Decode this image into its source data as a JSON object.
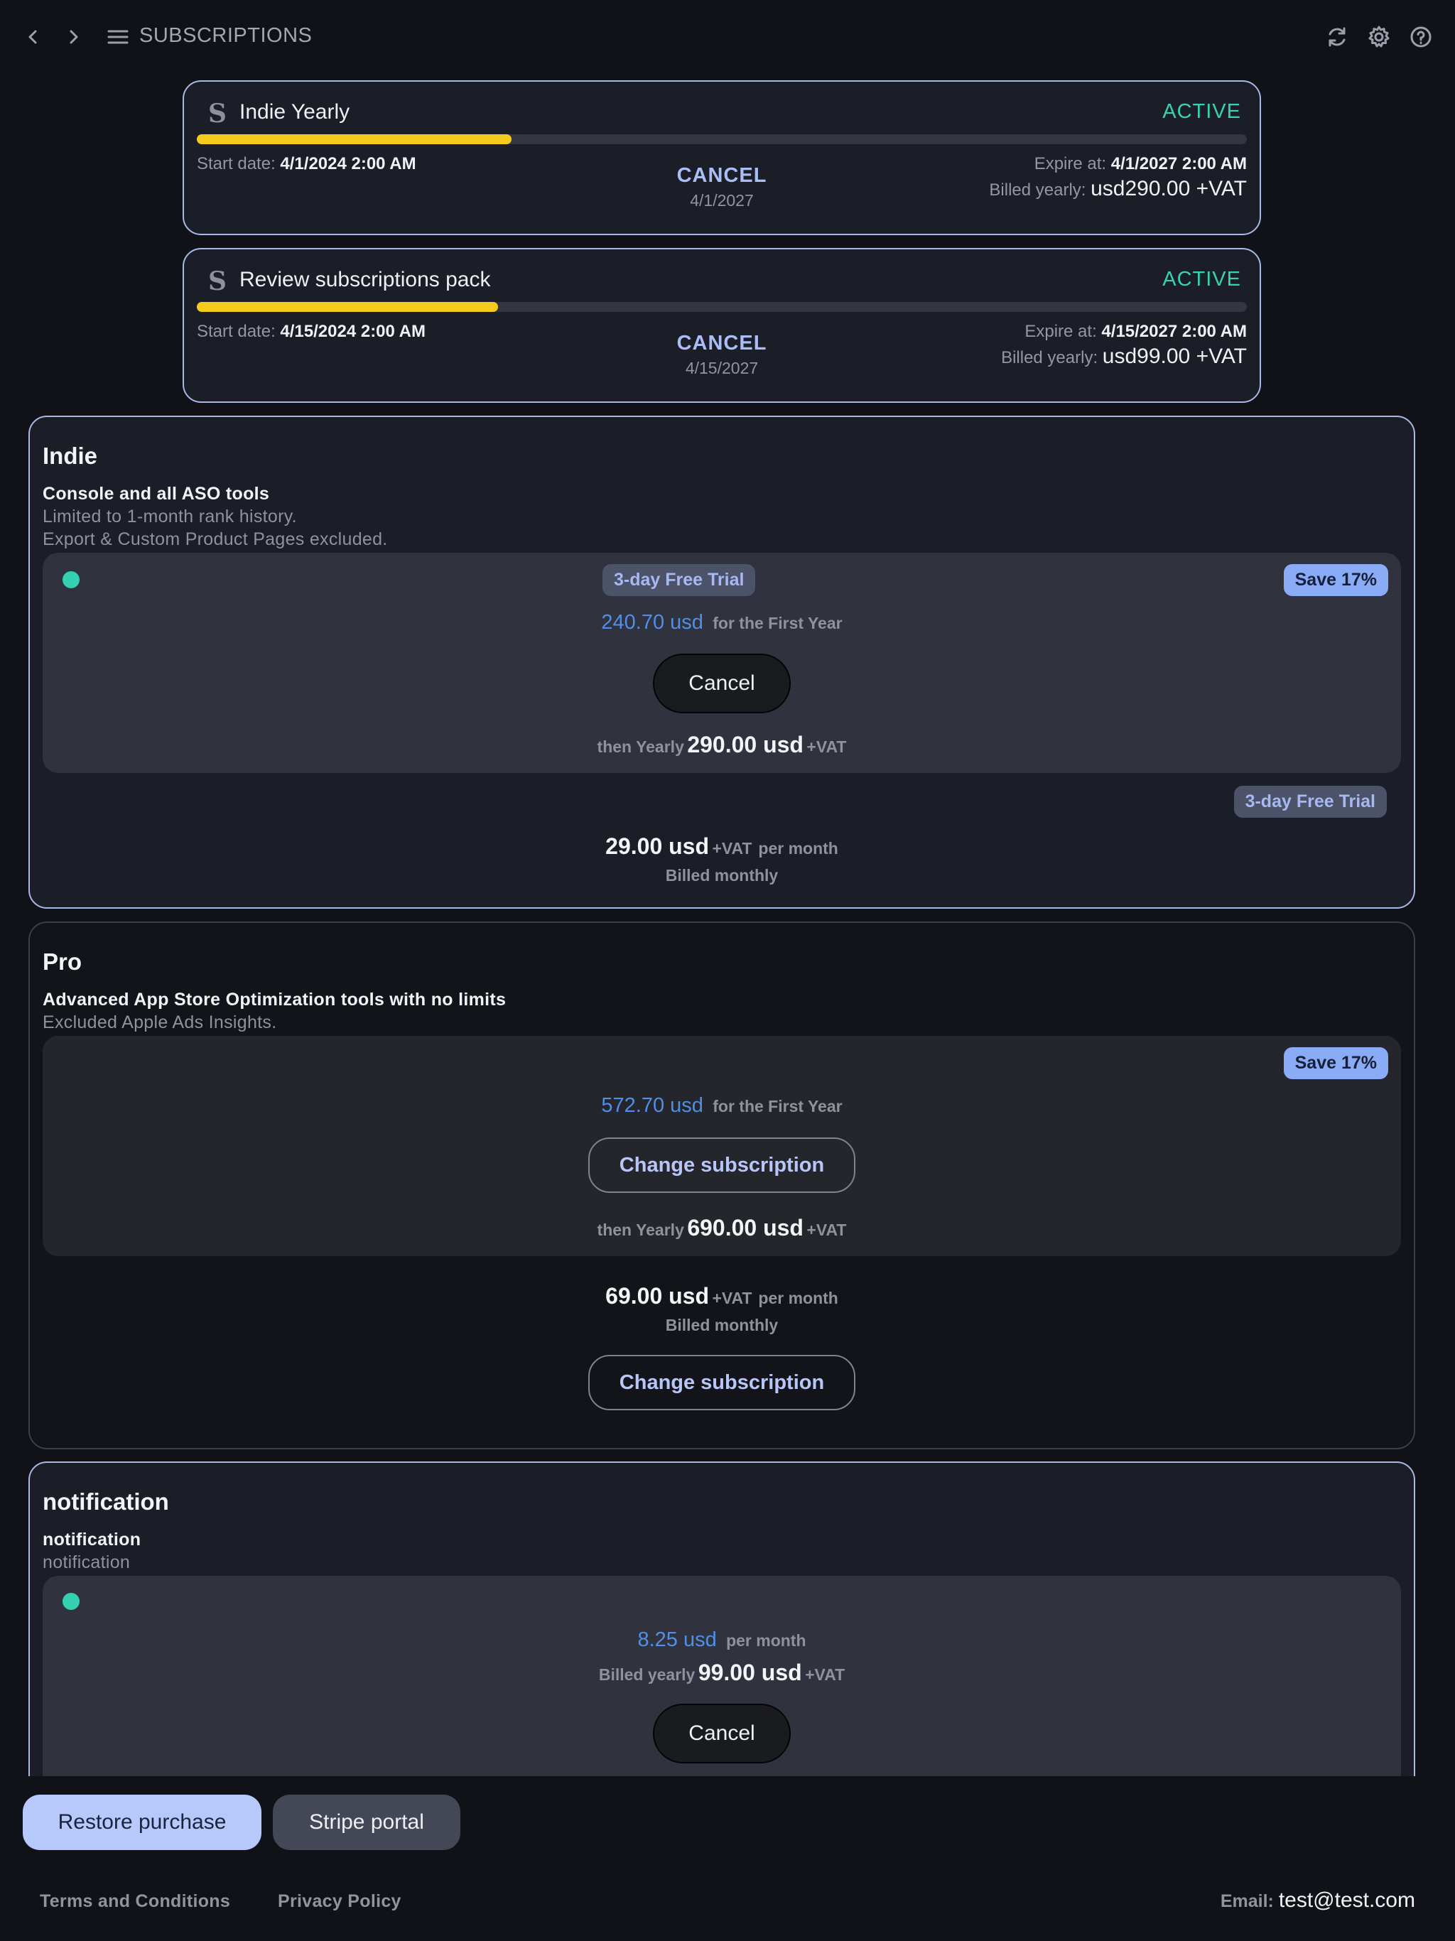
{
  "topbar": {
    "title": "SUBSCRIPTIONS",
    "icons": [
      "chevron-left-icon",
      "chevron-right-icon",
      "menu-icon",
      "refresh-icon",
      "gear-icon",
      "help-icon"
    ]
  },
  "active_subscriptions": [
    {
      "name": "Indie Yearly",
      "status": "ACTIVE",
      "progress": 0.3,
      "start_label": "Start date:",
      "start_value": "4/1/2024 2:00 AM",
      "cancel_label": "CANCEL",
      "cancel_date": "4/1/2027",
      "expire_label": "Expire at:",
      "expire_value": "4/1/2027 2:00 AM",
      "billed_label": "Billed yearly:",
      "billed_value": "usd290.00 +VAT"
    },
    {
      "name": "Review subscriptions pack",
      "status": "ACTIVE",
      "progress": 0.287,
      "start_label": "Start date:",
      "start_value": "4/15/2024 2:00 AM",
      "cancel_label": "CANCEL",
      "cancel_date": "4/15/2027",
      "expire_label": "Expire at:",
      "expire_value": "4/15/2027 2:00 AM",
      "billed_label": "Billed yearly:",
      "billed_value": "usd99.00 +VAT"
    }
  ],
  "plans": {
    "indie": {
      "title": "Indie",
      "description": "Console and all ASO tools",
      "notes": [
        "Limited to 1-month rank history.",
        "Export & Custom Product Pages excluded."
      ],
      "yearly": {
        "trial_badge": "3-day Free Trial",
        "save_badge": "Save 17%",
        "first_price": "240.70 usd",
        "first_suffix": "for the First Year",
        "button": "Cancel",
        "then_label": "then Yearly",
        "then_price": "290.00 usd",
        "vat": "+VAT"
      },
      "monthly": {
        "trial_badge": "3-day Free Trial",
        "price": "29.00 usd",
        "vat": "+VAT",
        "per": "per month",
        "billed": "Billed monthly"
      }
    },
    "pro": {
      "title": "Pro",
      "description": "Advanced App Store Optimization tools with no limits",
      "notes": [
        "Excluded Apple Ads Insights."
      ],
      "yearly": {
        "save_badge": "Save 17%",
        "first_price": "572.70 usd",
        "first_suffix": "for the First Year",
        "button": "Change subscription",
        "then_label": "then Yearly",
        "then_price": "690.00 usd",
        "vat": "+VAT"
      },
      "monthly": {
        "price": "69.00 usd",
        "vat": "+VAT",
        "per": "per month",
        "billed": "Billed monthly",
        "button": "Change subscription"
      }
    },
    "notification": {
      "title": "notification",
      "description": "notification",
      "notes": [
        "notification"
      ],
      "yearly": {
        "price": "8.25 usd",
        "per": "per month",
        "billed_label": "Billed yearly",
        "billed_price": "99.00 usd",
        "vat": "+VAT",
        "button": "Cancel"
      }
    }
  },
  "bottom": {
    "restore": "Restore purchase",
    "stripe": "Stripe portal",
    "terms": "Terms and Conditions",
    "privacy": "Privacy Policy",
    "email_label": "Email:",
    "email_value": "test@test.com"
  },
  "colors": {
    "background": "#111217",
    "accent": "#a9b8e6",
    "active": "#35d3b2",
    "progress": "#f5cc1c",
    "price_blue": "#4f8fe8"
  }
}
